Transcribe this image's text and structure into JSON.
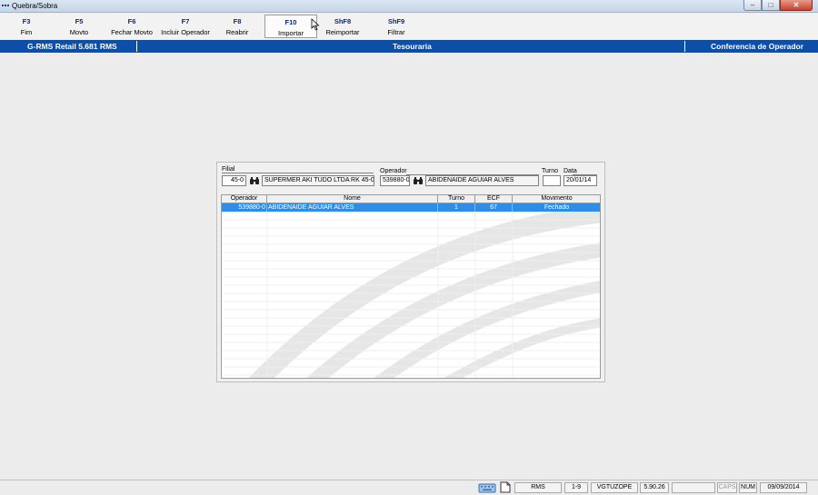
{
  "window": {
    "title": "Quebra/Sobra",
    "buttons": {
      "minimize": "–",
      "maximize": "□",
      "close": "✕"
    }
  },
  "toolbar": {
    "keys": [
      {
        "key": "F3",
        "label": "Fim"
      },
      {
        "key": "F5",
        "label": "Movto"
      },
      {
        "key": "F6",
        "label": "Fechar Movto"
      },
      {
        "key": "F7",
        "label": "Incluir Operador"
      },
      {
        "key": "F8",
        "label": "Reabrir"
      },
      {
        "key": "F10",
        "label": "Importar"
      },
      {
        "key": "ShF8",
        "label": "Reimportar"
      },
      {
        "key": "ShF9",
        "label": "Filtrar"
      }
    ]
  },
  "header": {
    "app": "G-RMS Retail 5.681 RMS",
    "module": "Tesouraria",
    "screen": "Conferencia de Operador"
  },
  "form": {
    "filial_label": "Filial",
    "filial_value": "45-0",
    "filial_name": "SUPERMER AKI TUDO LTDA RK 45-0",
    "operador_label": "Operador",
    "operador_value": "539880-0",
    "operador_name": "ABIDENAIDE AGUIAR ALVES",
    "turno_label": "Turno",
    "turno_value": "",
    "data_label": "Data",
    "data_value": "20/01/14"
  },
  "grid": {
    "columns": [
      "Operador",
      "Nome",
      "Turno",
      "ECF",
      "Movimento"
    ],
    "rows": [
      {
        "operador": "539880-0",
        "nome": "ABIDENAIDE AGUIAR ALVES",
        "turno": "1",
        "ecf": "67",
        "movimento": "Fechado"
      }
    ]
  },
  "statusbar": {
    "s1": "RMS",
    "s2": "1-9",
    "s3": "VGTUZOPE",
    "s4": "5.90.26",
    "s5": "",
    "caps": "CAPS",
    "num": "NUM",
    "date": "09/09/2014"
  },
  "colors": {
    "accent": "#0b4fa8",
    "selection": "#2f8de6"
  }
}
